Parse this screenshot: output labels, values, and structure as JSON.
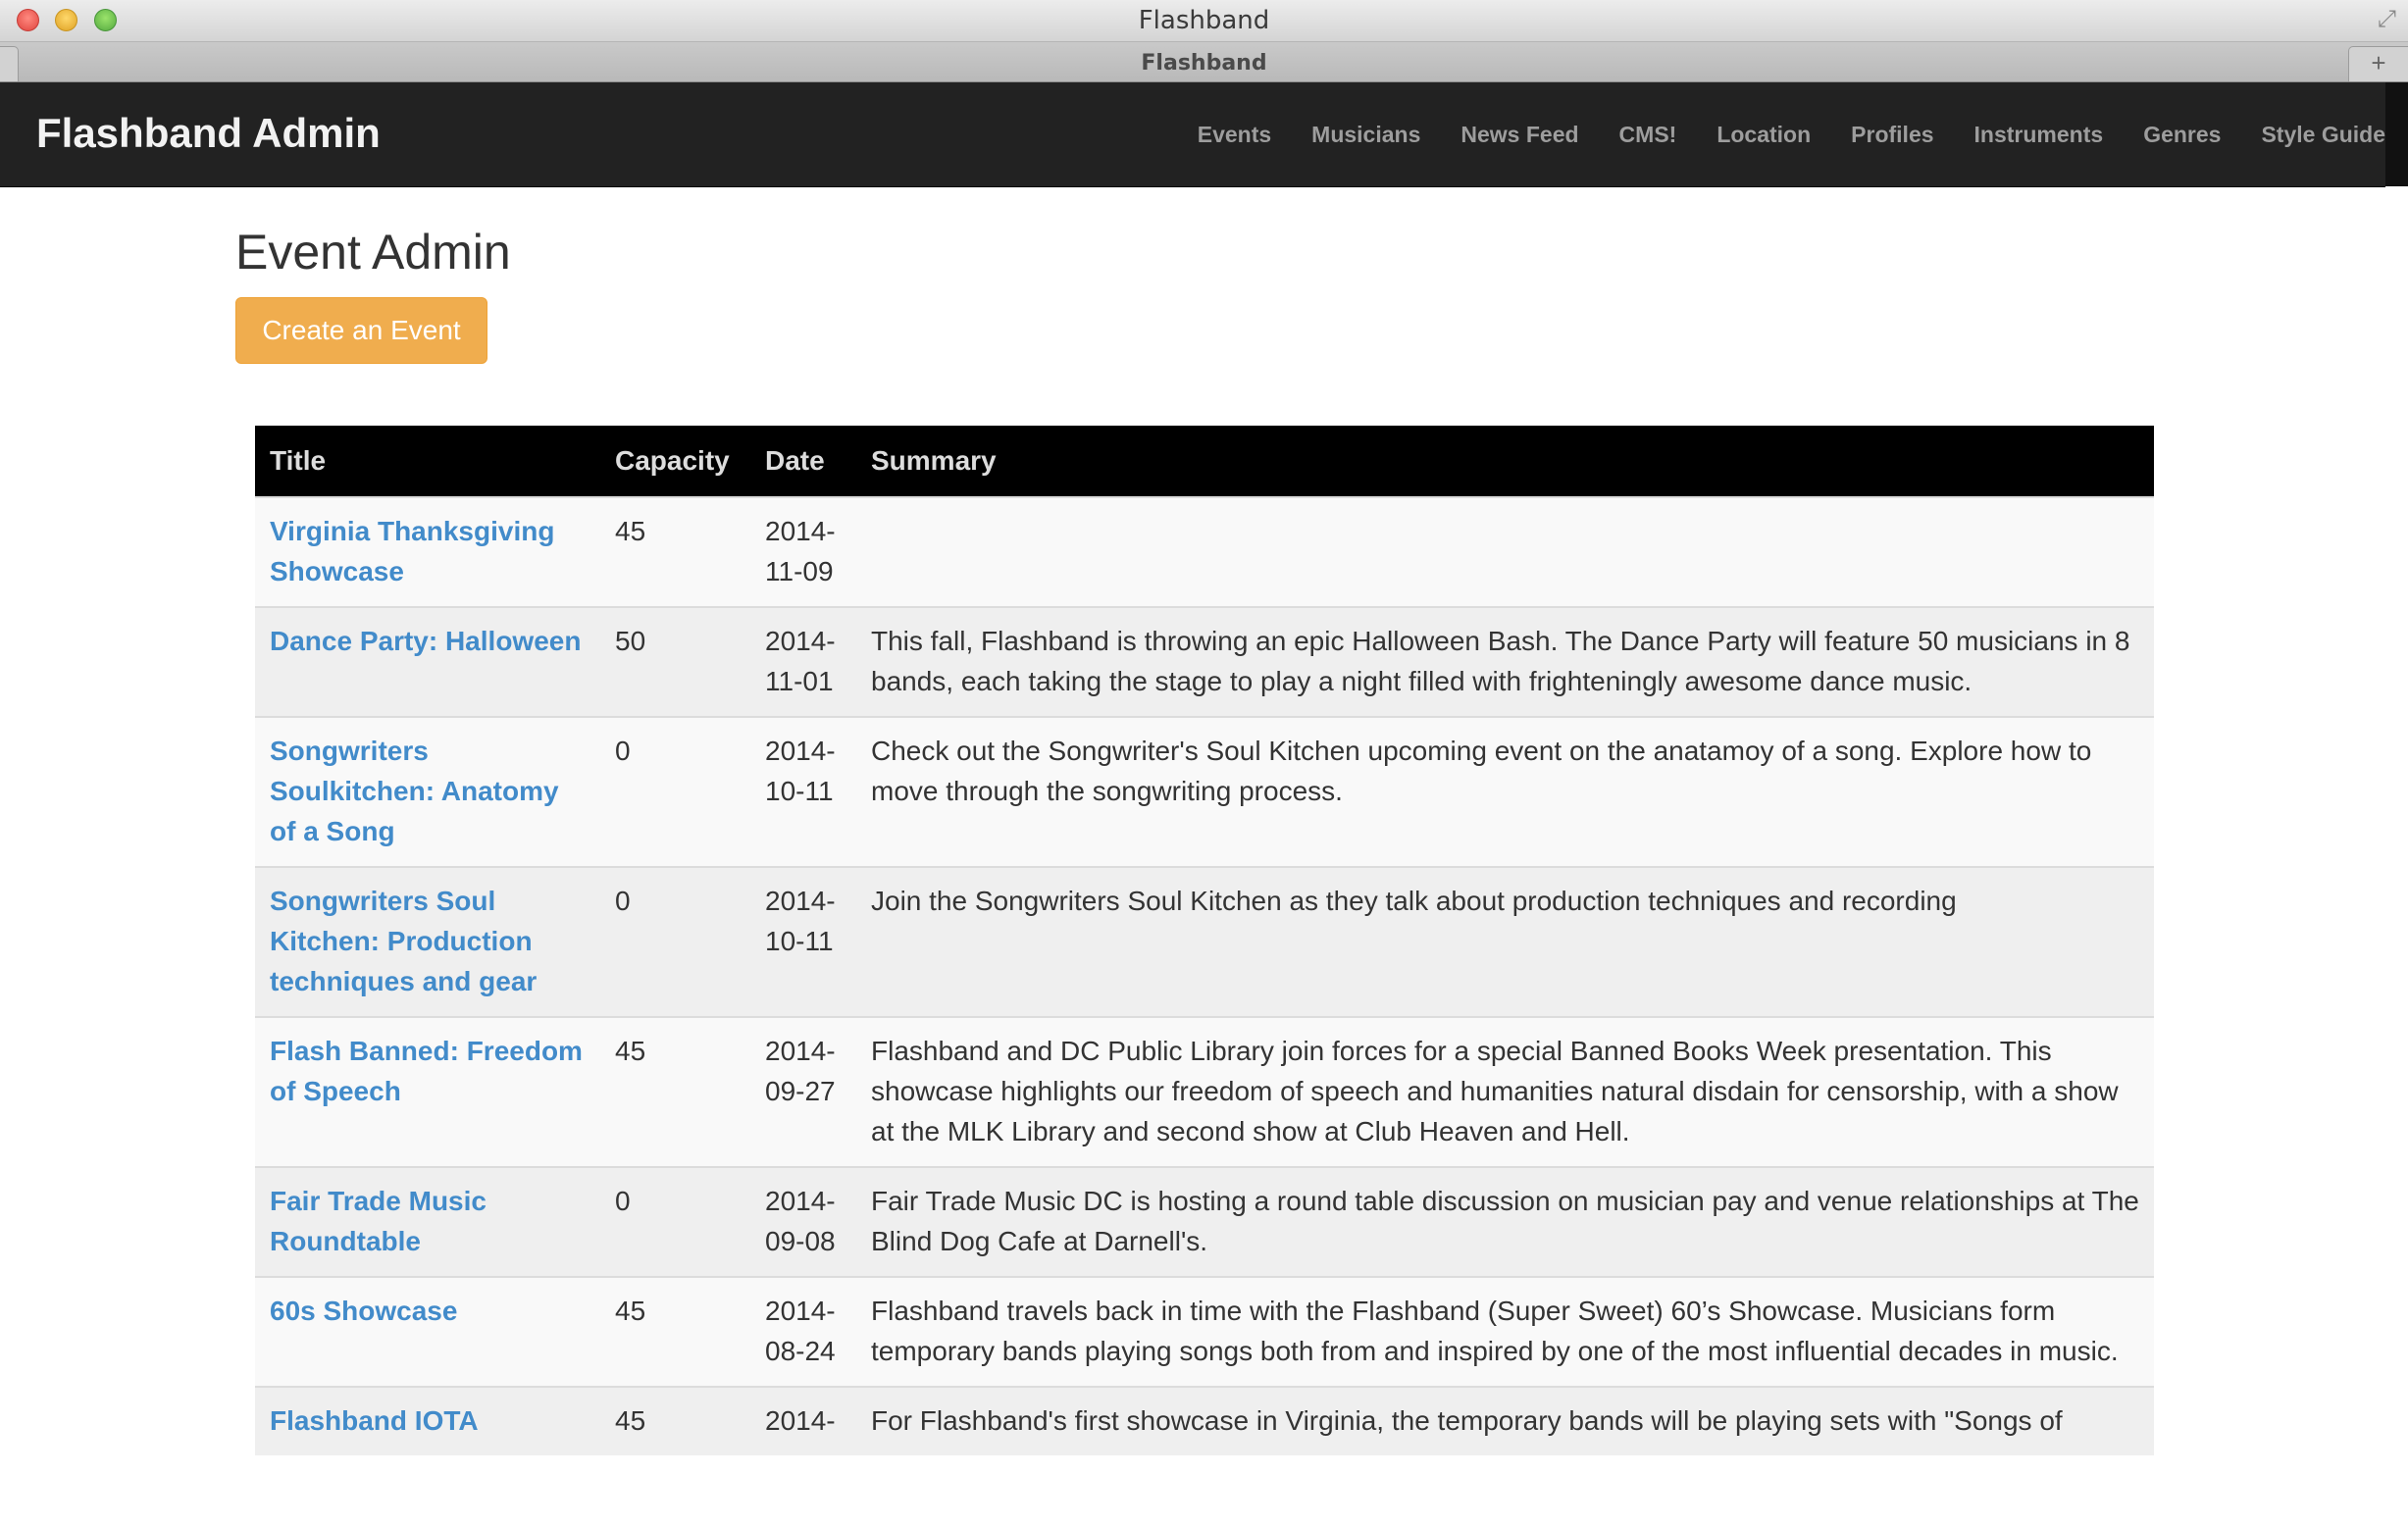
{
  "window": {
    "title": "Flashband",
    "tab_title": "Flashband",
    "new_tab_label": "+",
    "fullscreen_glyph": "⤢"
  },
  "navbar": {
    "brand": "Flashband Admin",
    "links": [
      "Events",
      "Musicians",
      "News Feed",
      "CMS!",
      "Location",
      "Profiles",
      "Instruments",
      "Genres",
      "Style Guide"
    ]
  },
  "page": {
    "title": "Event Admin",
    "create_button": "Create an Event",
    "accent_color": "#f0ad4e",
    "link_color": "#428bca"
  },
  "table": {
    "headers": [
      "Title",
      "Capacity",
      "Date",
      "Summary"
    ],
    "rows": [
      {
        "title": "Virginia Thanksgiving Showcase",
        "capacity": "45",
        "date": "2014-11-09",
        "summary": ""
      },
      {
        "title": "Dance Party: Halloween",
        "capacity": "50",
        "date": "2014-11-01",
        "summary": "This fall, Flashband is throwing an epic Halloween Bash. The Dance Party will feature 50 musicians in 8 bands, each taking the stage to play a night filled with frighteningly awesome dance music."
      },
      {
        "title": "Songwriters Soulkitchen: Anatomy of a Song",
        "capacity": "0",
        "date": "2014-10-11",
        "summary": "Check out the Songwriter's Soul Kitchen upcoming event on the anatamoy of a song. Explore how to move through the songwriting process."
      },
      {
        "title": "Songwriters Soul Kitchen: Production techniques and gear",
        "capacity": "0",
        "date": "2014-10-11",
        "summary": "Join the Songwriters Soul Kitchen as they talk about production techniques and recording"
      },
      {
        "title": "Flash Banned: Freedom of Speech",
        "capacity": "45",
        "date": "2014-09-27",
        "summary": "Flashband and DC Public Library join forces for a special Banned Books Week presentation. This showcase highlights our freedom of speech and humanities natural disdain for censorship, with a show at the MLK Library and second show at Club Heaven and Hell."
      },
      {
        "title": "Fair Trade Music Roundtable",
        "capacity": "0",
        "date": "2014-09-08",
        "summary": "Fair Trade Music DC is hosting a round table discussion on musician pay and venue relationships at The Blind Dog Cafe at Darnell's."
      },
      {
        "title": "60s Showcase",
        "capacity": "45",
        "date": "2014-08-24",
        "summary": "Flashband travels back in time with the Flashband (Super Sweet) 60’s Showcase. Musicians form temporary bands playing songs both from and inspired by one of the most influential decades in music."
      },
      {
        "title": "Flashband IOTA",
        "capacity": "45",
        "date": "2014-",
        "summary": "For Flashband's first showcase in Virginia, the temporary bands will be playing sets with \"Songs of"
      }
    ]
  }
}
